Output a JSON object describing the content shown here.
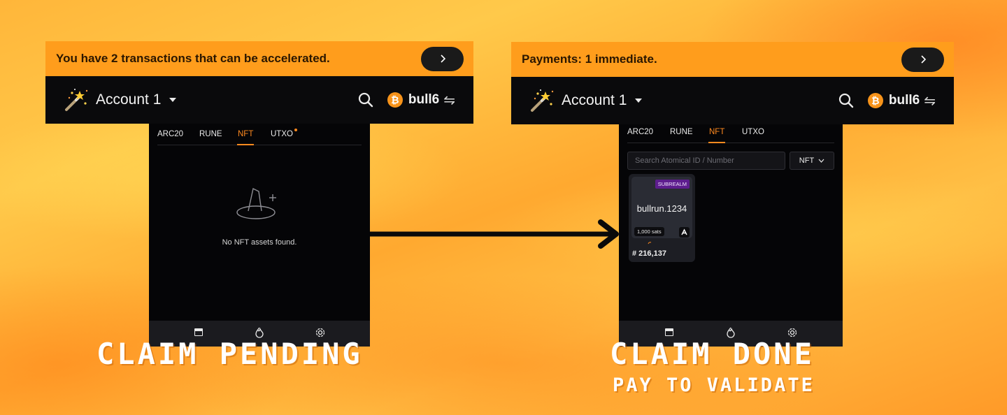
{
  "left": {
    "banner": {
      "text": "You have 2 transactions that can be accelerated.",
      "button_icon": "chevron-right-icon"
    },
    "header": {
      "account": "Account 1",
      "user": "bull6",
      "swap_symbol": "⇋",
      "btc_symbol": "₿"
    },
    "tabs": [
      "ARC20",
      "RUNE",
      "NFT",
      "UTXO"
    ],
    "active_tab": "NFT",
    "empty_message": "No NFT assets found.",
    "caption": "CLAIM PENDING"
  },
  "right": {
    "banner": {
      "text": "Payments: 1 immediate.",
      "button_icon": "chevron-right-icon"
    },
    "header": {
      "account": "Account 1",
      "user": "bull6",
      "swap_symbol": "⇋",
      "btc_symbol": "₿"
    },
    "tabs": [
      "ARC20",
      "RUNE",
      "NFT",
      "UTXO"
    ],
    "active_tab": "NFT",
    "search_placeholder": "Search Atomical ID / Number",
    "filter_select": "NFT",
    "card": {
      "badge": "SUBREALM",
      "name": "bullrun.1234",
      "price": "1,000 sats",
      "number": "# 216,137"
    },
    "caption": "CLAIM DONE",
    "subcaption": "PAY TO VALIDATE"
  },
  "colors": {
    "banner": "#ff9d1c",
    "accent": "#ff8a1f",
    "panel_bg": "#050507",
    "badge": "#5d1d8e"
  },
  "icons": [
    "magic-wand-icon",
    "search-icon",
    "bitcoin-icon",
    "wallet-icon",
    "flame-icon",
    "gear-icon",
    "witch-hat-icon",
    "atom-icon"
  ]
}
